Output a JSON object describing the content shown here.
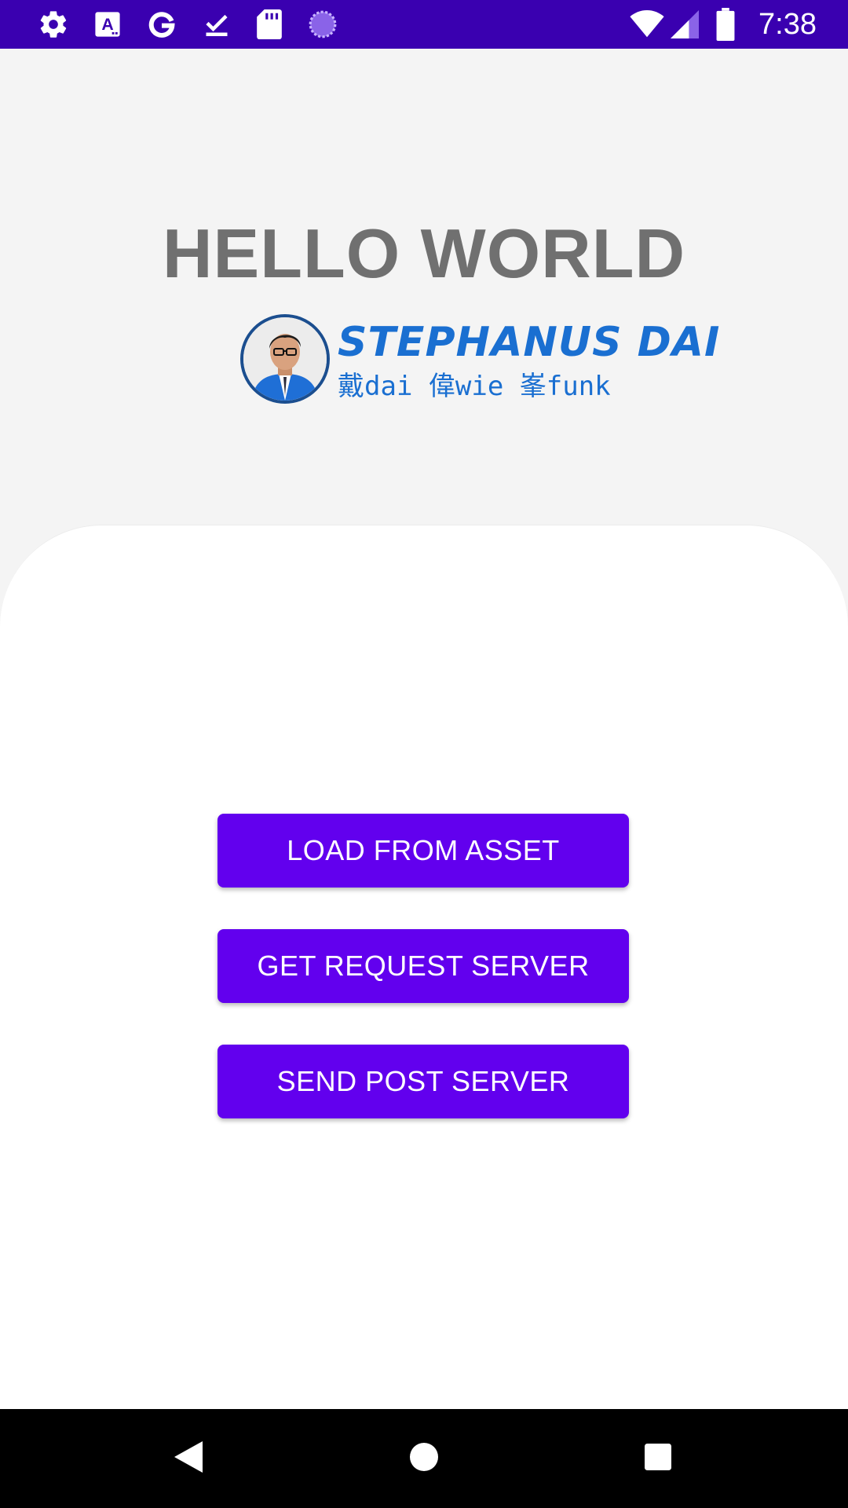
{
  "status_bar": {
    "time": "7:38",
    "left_icons": [
      "settings-icon",
      "font-a-icon",
      "google-g-icon",
      "download-done-icon",
      "sd-card-icon",
      "loading-circle-icon"
    ],
    "right_icons": [
      "wifi-icon",
      "cell-signal-icon",
      "battery-icon"
    ],
    "background": "#3a00b0"
  },
  "header": {
    "title": "HELLO WORLD",
    "logo": {
      "name": "STEPHANUS DAI",
      "subtitle": "戴dai 偉wie 峯funk"
    }
  },
  "actions": {
    "load_asset": "LOAD FROM ASSET",
    "get_request": "GET REQUEST SERVER",
    "send_post": "SEND POST SERVER",
    "button_color": "#6200ee"
  },
  "nav_bar": {
    "icons": [
      "back-icon",
      "home-icon",
      "recents-icon"
    ]
  }
}
